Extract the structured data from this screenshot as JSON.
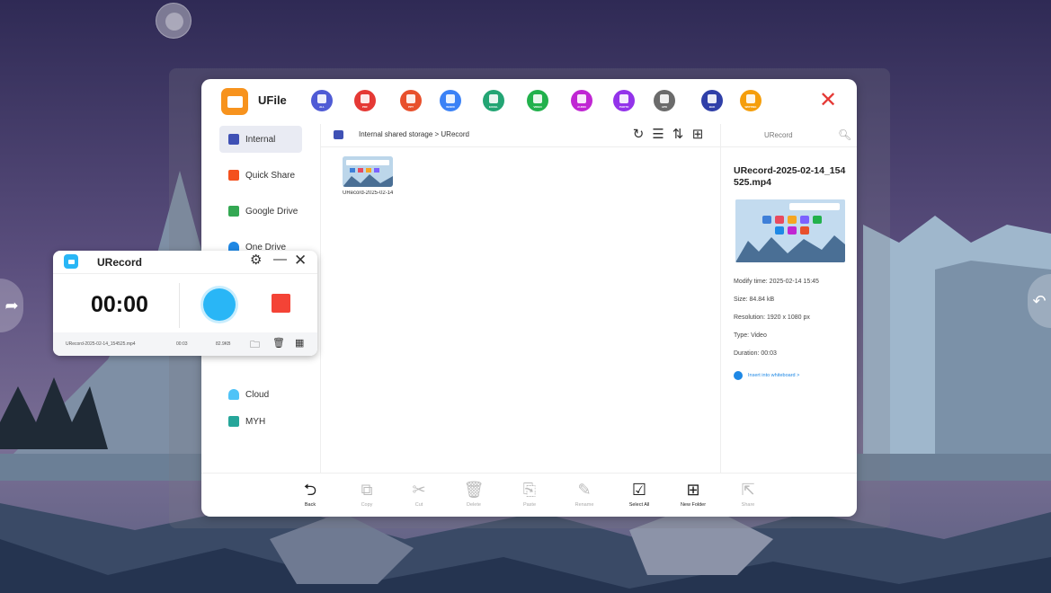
{
  "colors": {
    "accent_orange": "#f7931e",
    "close_red": "#e53935",
    "record_blue": "#29b6f6",
    "stop_red": "#f44336",
    "link_blue": "#1e88e5"
  },
  "ufile": {
    "title": "UFile",
    "categories": [
      {
        "label": "ALL",
        "color": "#4f5bd5",
        "icon": "all-icon"
      },
      {
        "label": "PDF",
        "color": "#e53935",
        "icon": "pdf-icon"
      },
      {
        "label": "PPT",
        "color": "#e8502c",
        "icon": "ppt-icon"
      },
      {
        "label": "WORD",
        "color": "#3b82f6",
        "icon": "word-icon"
      },
      {
        "label": "EXCEL",
        "color": "#23a574",
        "icon": "excel-icon"
      },
      {
        "label": "VIDEO",
        "color": "#22b14c",
        "icon": "video-icon"
      },
      {
        "label": "AUDIO",
        "color": "#c026d3",
        "icon": "audio-icon"
      },
      {
        "label": "PHOTO",
        "color": "#9333ea",
        "icon": "photo-icon"
      },
      {
        "label": "APK",
        "color": "#6b6b6b",
        "icon": "apk-icon"
      },
      {
        "label": "BAK",
        "color": "#2f3fa8",
        "icon": "bak-icon"
      },
      {
        "label": "WRITING",
        "color": "#f59e0b",
        "icon": "writing-icon"
      }
    ],
    "sidebar": [
      {
        "label": "Internal",
        "icon": "storage-icon",
        "active": true
      },
      {
        "label": "Quick Share",
        "icon": "lightning-icon"
      },
      {
        "label": "Google Drive",
        "icon": "google-drive-icon"
      },
      {
        "label": "One Drive",
        "icon": "cloud-icon"
      },
      {
        "label": "Cloud",
        "icon": "cloud-icon"
      },
      {
        "label": "MYH",
        "icon": "myh-icon"
      }
    ],
    "path": "Internal shared storage >  URecord",
    "files": [
      {
        "name": "URecord-2025-02-14_154525.mp4"
      }
    ],
    "search_placeholder": "URecord",
    "detail": {
      "title": "URecord-2025-02-14_154525.mp4",
      "modify_time": "Modify time: 2025-02-14 15:45",
      "size": "Size: 84.84 kB",
      "resolution": "Resolution: 1920 x 1080 px",
      "type": "Type: Video",
      "duration": "Duration: 00:03",
      "insert_link": "Insert into whiteboard >"
    },
    "toolbar": [
      {
        "label": "Back",
        "glyph": "⮌",
        "icon": "back-icon",
        "enabled": true
      },
      {
        "label": "Copy",
        "glyph": "⧉",
        "icon": "copy-icon",
        "enabled": false
      },
      {
        "label": "Cut",
        "glyph": "✂",
        "icon": "scissors-icon",
        "enabled": false
      },
      {
        "label": "Delete",
        "glyph": "🗑",
        "icon": "trash-icon",
        "enabled": false
      },
      {
        "label": "Paste",
        "glyph": "⎘",
        "icon": "paste-icon",
        "enabled": false
      },
      {
        "label": "Rename",
        "glyph": "✎",
        "icon": "rename-icon",
        "enabled": false
      },
      {
        "label": "Select All",
        "glyph": "☑",
        "icon": "select-all-icon",
        "enabled": true
      },
      {
        "label": "New Folder",
        "glyph": "⊞",
        "icon": "new-folder-icon",
        "enabled": true
      },
      {
        "label": "Share",
        "glyph": "⇱",
        "icon": "share-icon",
        "enabled": false
      }
    ]
  },
  "urecord": {
    "title": "URecord",
    "timer": "00:00",
    "last_file": "URecord-2025-02-14_154525.mp4",
    "duration": "00:03",
    "size": "82.9KB"
  }
}
